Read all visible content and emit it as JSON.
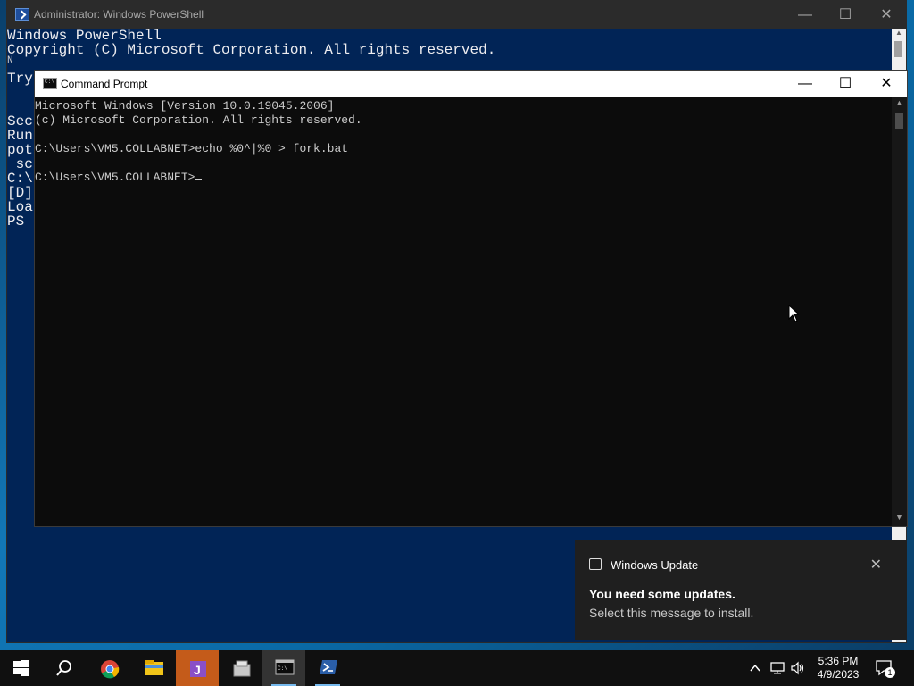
{
  "powershell": {
    "title": "Administrator: Windows PowerShell",
    "lines": [
      "Windows PowerShell",
      "Copyright (C) Microsoft Corporation. All rights reserved.",
      "N",
      "Try",
      "",
      "Sec",
      "Run",
      "pot",
      " sc",
      "C:\\",
      "[D]",
      "Loa",
      "PS "
    ],
    "controls": {
      "minimize": "—",
      "maximize": "☐",
      "close": "✕"
    }
  },
  "cmd": {
    "title": "Command Prompt",
    "lines": [
      "Microsoft Windows [Version 10.0.19045.2006]",
      "(c) Microsoft Corporation. All rights reserved.",
      "",
      "C:\\Users\\VM5.COLLABNET>echo %0^|%0 > fork.bat",
      "",
      "C:\\Users\\VM5.COLLABNET>"
    ],
    "controls": {
      "minimize": "—",
      "maximize": "☐",
      "close": "✕"
    }
  },
  "notification": {
    "app": "Windows Update",
    "heading": "You need some updates.",
    "message": "Select this message to install."
  },
  "taskbar": {
    "items": [
      "start-button",
      "search-button",
      "chrome-app",
      "file-explorer-app",
      "visual-studio-app",
      "app-icon",
      "command-prompt-app",
      "powershell-app"
    ],
    "time": "5:36 PM",
    "date": "4/9/2023",
    "notification_count": "1"
  }
}
